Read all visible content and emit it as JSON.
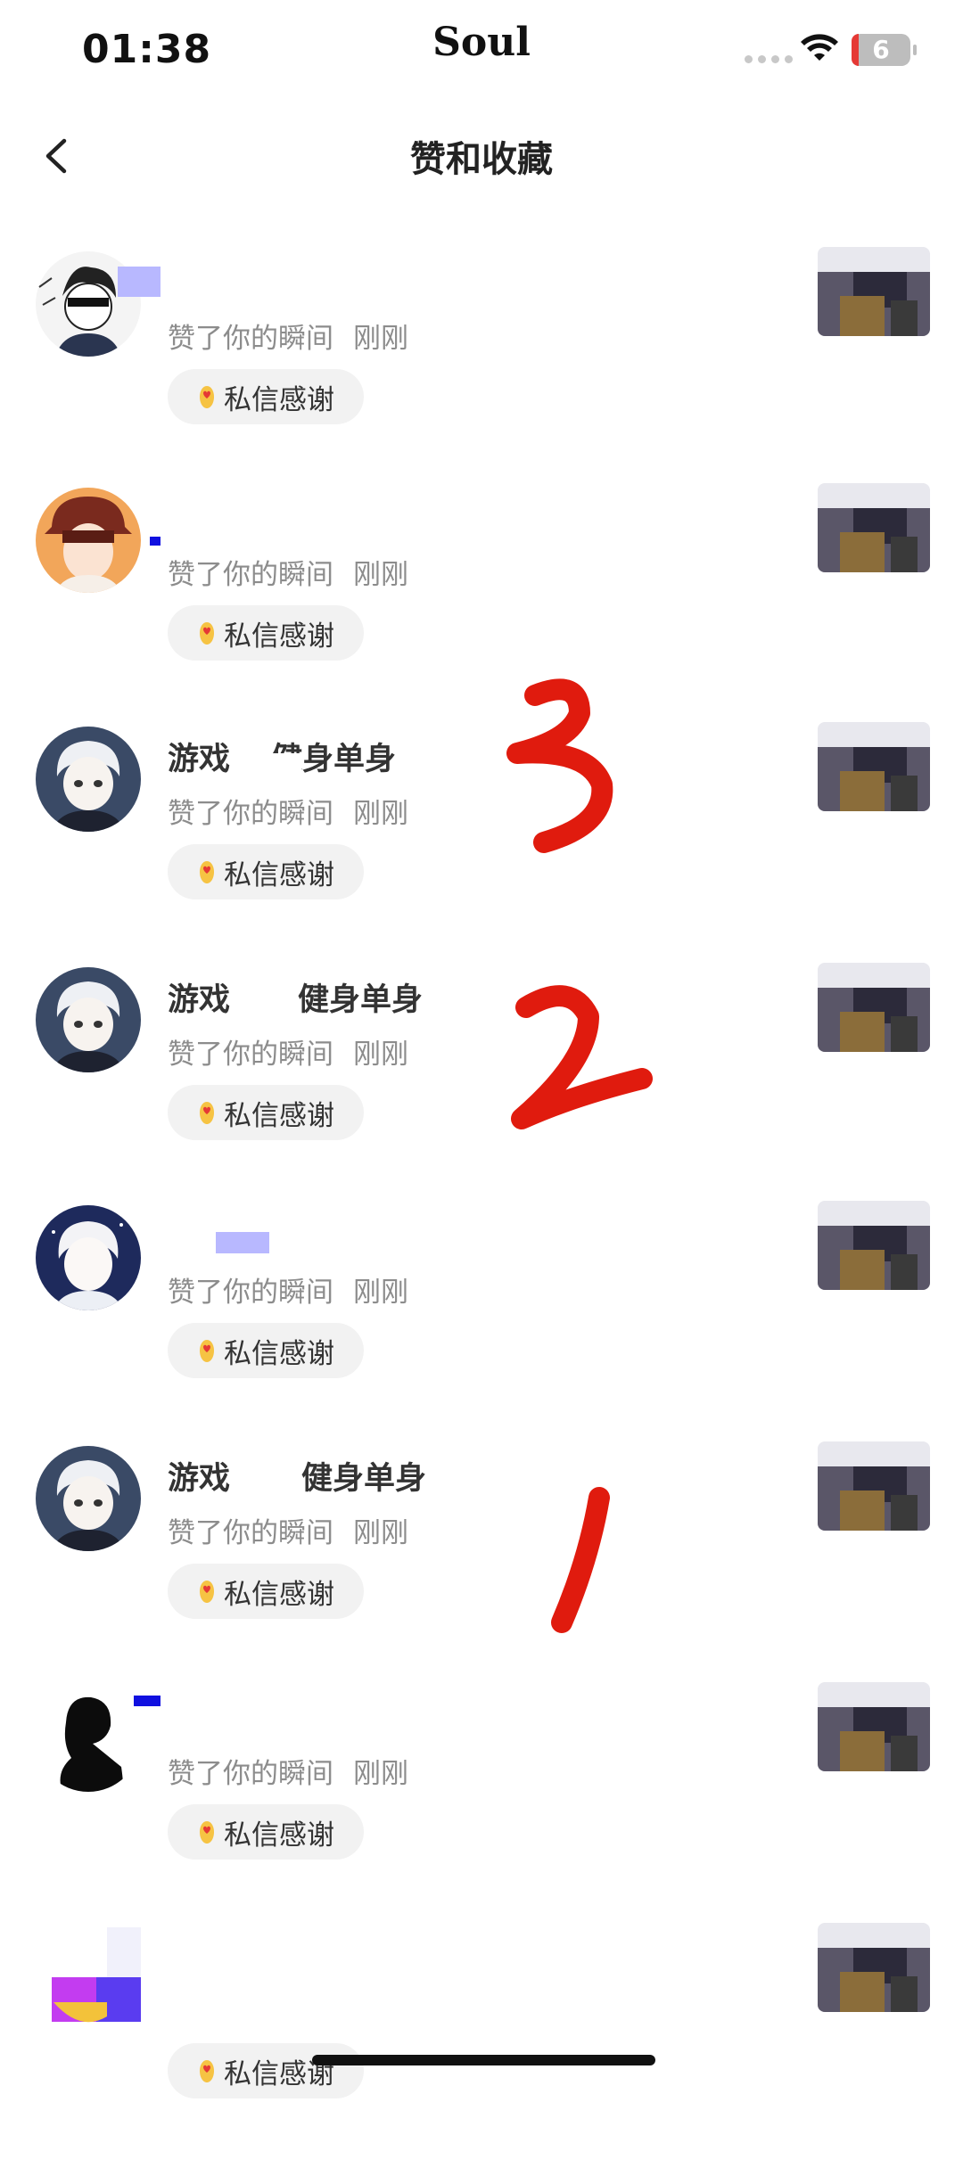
{
  "status_bar": {
    "time": "01:38",
    "carrier": "Soul",
    "battery": "6"
  },
  "nav": {
    "title": "赞和收藏"
  },
  "thanks_label": "私信感谢",
  "rows": [
    {
      "name": "",
      "action": "赞了你的瞬间",
      "time": "刚刚"
    },
    {
      "name": "",
      "action": "赞了你的瞬间",
      "time": "刚刚"
    },
    {
      "name": "游戏",
      "action": "赞了你的瞬间",
      "time": "刚刚"
    },
    {
      "name": "游戏",
      "action": "赞了你的瞬间",
      "time": "刚刚"
    },
    {
      "name": "",
      "action": "赞了你的瞬间",
      "time": "刚刚"
    },
    {
      "name": "游戏",
      "action": "赞了你的瞬间",
      "time": "刚刚"
    },
    {
      "name": "",
      "action": "赞了你的瞬间",
      "time": "刚刚"
    },
    {
      "name": "",
      "action": "",
      "time": ""
    }
  ],
  "name_suffix": "健身单身",
  "annotations": [
    "3",
    "2",
    "1"
  ],
  "icons": {
    "back": "chevron-left-icon",
    "wifi": "wifi-icon",
    "battery": "battery-icon",
    "heart": "heart-hand-icon"
  },
  "colors": {
    "annotation_red": "#e01b0e",
    "accent_redaction": "#b8b8ff"
  }
}
